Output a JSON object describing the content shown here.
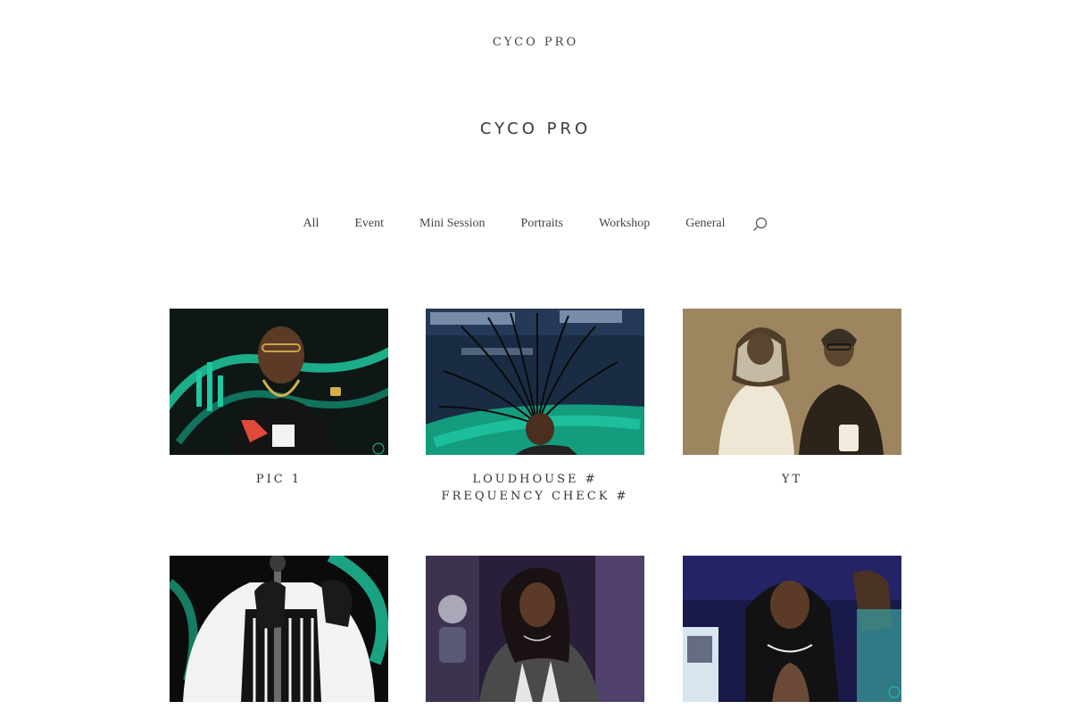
{
  "site": {
    "brand": "CYCO PRO",
    "title": "CYCO PRO"
  },
  "filters": [
    {
      "label": "All"
    },
    {
      "label": "Event"
    },
    {
      "label": "Mini Session"
    },
    {
      "label": "Portraits"
    },
    {
      "label": "Workshop"
    },
    {
      "label": "General"
    }
  ],
  "icons": {
    "search": "search-icon"
  },
  "gallery": [
    {
      "title": "PIC 1",
      "image": "man-black-tee-gold-chain-photo"
    },
    {
      "title": "LOUDHOUSE # FREQUENCY CHECK #",
      "image": "hair-flip-dreadlocks-photo"
    },
    {
      "title": "YT",
      "image": "two-people-sepia-photo"
    },
    {
      "title": "",
      "image": "chef-apron-microphone-photo"
    },
    {
      "title": "",
      "image": "woman-grey-sweatshirt-photo"
    },
    {
      "title": "",
      "image": "woman-long-curly-hair-photo"
    }
  ],
  "colors": {
    "text": "#333333",
    "background": "#ffffff",
    "neon_green": "#1ec8a0"
  }
}
